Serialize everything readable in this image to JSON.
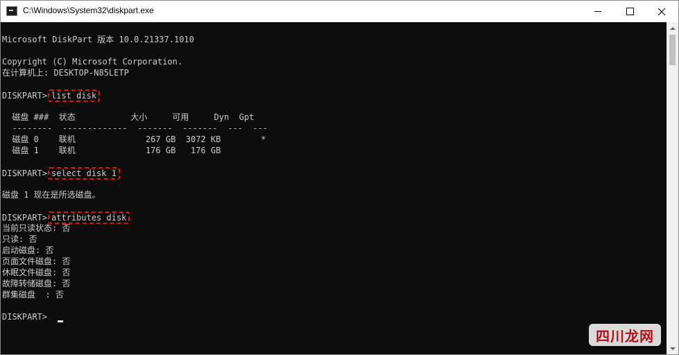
{
  "window": {
    "title": "C:\\Windows\\System32\\diskpart.exe",
    "icon": "console-icon",
    "controls": [
      "minimize-icon",
      "maximize-icon",
      "close-icon"
    ]
  },
  "console": {
    "lines": [
      "Microsoft DiskPart 版本 10.0.21337.1010",
      "",
      "Copyright (C) Microsoft Corporation.",
      "在计算机上: DESKTOP-N85LETP",
      "",
      "DISKPART>",
      "",
      "  磁盘 ###  状态           大小     可用     Dyn  Gpt",
      "  --------  -------------  -------  -------  ---  ---",
      "  磁盘 0    联机              267 GB  3072 KB        *",
      "  磁盘 1    联机              176 GB   176 GB",
      "",
      "DISKPART>",
      "",
      "磁盘 1 现在是所选磁盘。",
      "",
      "DISKPART>",
      "当前只读状态: 否",
      "只读: 否",
      "启动磁盘: 否",
      "页面文件磁盘: 否",
      "休眠文件磁盘: 否",
      "故障转储磁盘: 否",
      "群集磁盘  : 否",
      "",
      "DISKPART>"
    ],
    "commands": {
      "list_disk": "list disk",
      "select_disk": "select disk 1",
      "attributes_disk": "attributes disk"
    },
    "highlight_color": "#e81010"
  },
  "watermark": {
    "text": "四川龙网"
  }
}
